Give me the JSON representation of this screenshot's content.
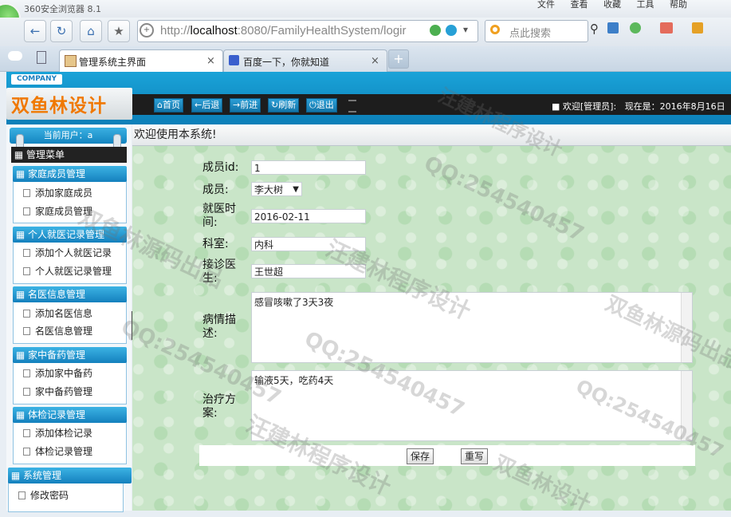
{
  "browser": {
    "title": "360安全浏览器 8.1",
    "menu": [
      "文件",
      "查看",
      "收藏",
      "工具",
      "帮助"
    ],
    "url_prefix": "http://",
    "url_host": "localhost",
    "url_rest": ":8080/FamilyHealthSystem/logir",
    "search_placeholder": "点此搜索",
    "tabs": [
      {
        "label": "管理系统主界面",
        "active": true
      },
      {
        "label": "百度一下，你就知道",
        "active": false
      }
    ]
  },
  "header": {
    "company": "COMPANY",
    "brand": "双鱼林设计",
    "nav_buttons": [
      "首页",
      "后退",
      "前进",
      "刷新",
      "退出"
    ],
    "welcome": "欢迎[管理员]:",
    "now": "现在是：2016年8月16日"
  },
  "sidebar": {
    "current_user": "当前用户：a",
    "admin_menu": "管理菜单",
    "sections": [
      {
        "title": "家庭成员管理",
        "items": [
          "添加家庭成员",
          "家庭成员管理"
        ]
      },
      {
        "title": "个人就医记录管理",
        "items": [
          "添加个人就医记录",
          "个人就医记录管理"
        ]
      },
      {
        "title": "名医信息管理",
        "items": [
          "添加名医信息",
          "名医信息管理"
        ]
      },
      {
        "title": "家中备药管理",
        "items": [
          "添加家中备药",
          "家中备药管理"
        ]
      },
      {
        "title": "体检记录管理",
        "items": [
          "添加体检记录",
          "体检记录管理"
        ]
      },
      {
        "title": "系统管理",
        "items": [
          "修改密码"
        ]
      }
    ]
  },
  "content": {
    "title": "欢迎使用本系统!",
    "form": {
      "id_label": "成员id:",
      "id_value": "1",
      "member_label": "成员:",
      "member_value": "李大树",
      "date_label": "就医时间:",
      "date_value": "2016-02-11",
      "dept_label": "科室:",
      "dept_value": "内科",
      "doctor_label": "接诊医生:",
      "doctor_value": "王世超",
      "desc_label": "病情描述:",
      "desc_value": "感冒咳嗽了3天3夜",
      "plan_label": "治疗方案:",
      "plan_value": "输液5天，吃药4天"
    },
    "save_label": "保存",
    "reset_label": "重写"
  },
  "watermarks": [
    "QQ:254540457",
    "汪建林程序设计",
    "双鱼林源码出品",
    "双鱼林设计"
  ]
}
